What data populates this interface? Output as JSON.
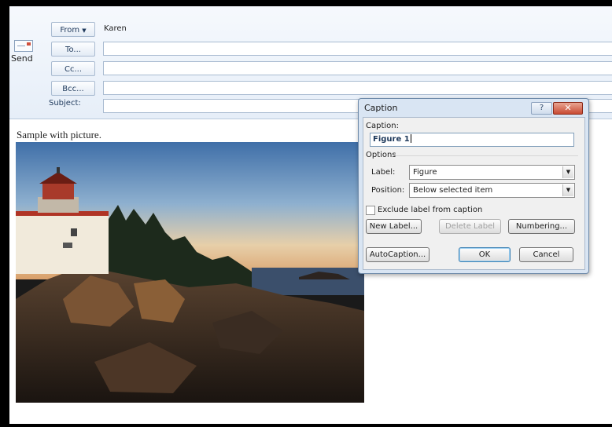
{
  "compose": {
    "send_label": "Send",
    "from_label": "From",
    "from_value": "Karen",
    "to_label": "To...",
    "cc_label": "Cc...",
    "bcc_label": "Bcc...",
    "subject_label": "Subject:"
  },
  "body": {
    "text": "Sample with picture."
  },
  "dialog": {
    "title": "Caption",
    "help_label": "?",
    "close_label": "✕",
    "caption_label": "Caption:",
    "caption_value": "Figure 1",
    "options_label": "Options",
    "label_label": "Label:",
    "label_value": "Figure",
    "position_label": "Position:",
    "position_value": "Below selected item",
    "exclude_label": "Exclude label from caption",
    "exclude_checked": false,
    "new_label_button": "New Label...",
    "delete_label_button": "Delete Label",
    "numbering_button": "Numbering...",
    "autocaption_button": "AutoCaption...",
    "ok_button": "OK",
    "cancel_button": "Cancel"
  },
  "icons": {
    "send": "send-envelope-icon",
    "dropdown": "chevron-down-icon",
    "help": "help-icon",
    "close": "close-icon"
  },
  "colors": {
    "header_bg": "#e6eef8",
    "close_red": "#c84a33",
    "dialog_frame": "#d9e5f3"
  }
}
